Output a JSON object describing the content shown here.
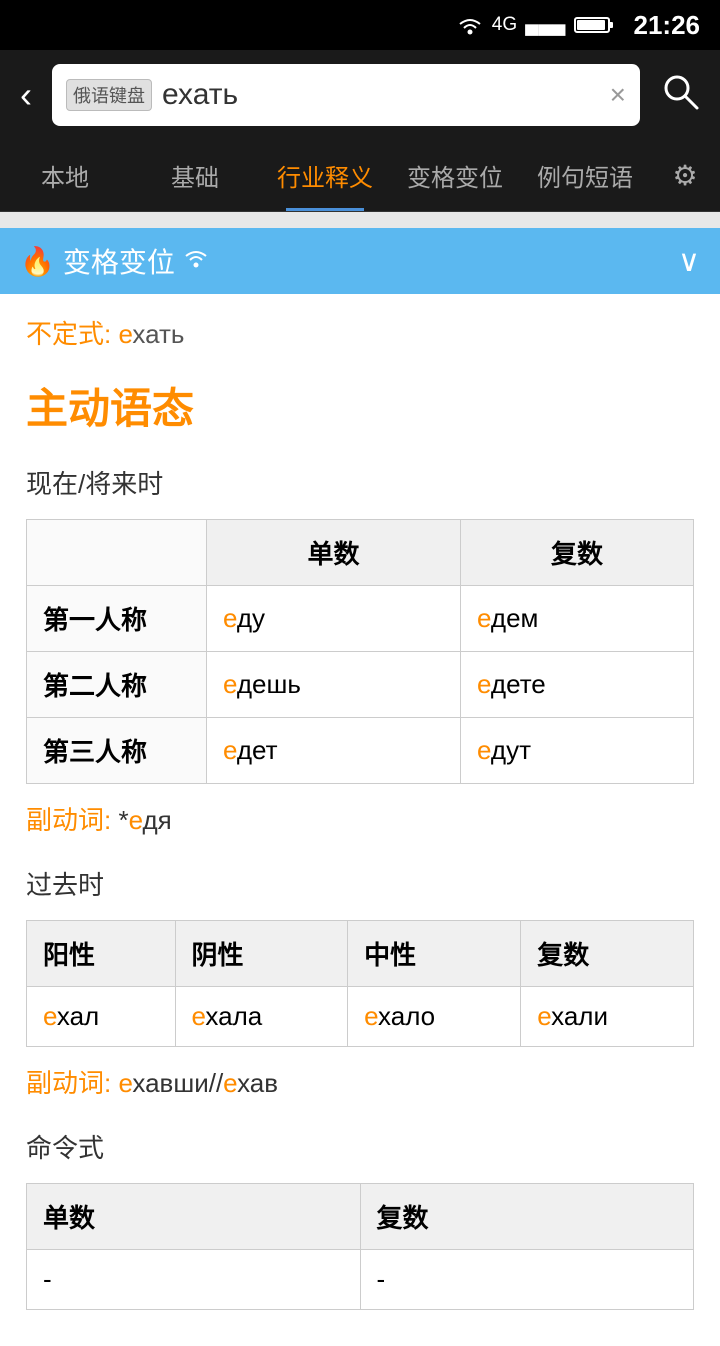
{
  "statusBar": {
    "time": "21:26",
    "icons": [
      "wifi",
      "4g",
      "signal",
      "battery"
    ]
  },
  "topBar": {
    "backLabel": "‹",
    "keyboardBadge": "俄语键盘",
    "searchText": "ехать",
    "clearIcon": "×",
    "searchIcon": "⌕"
  },
  "tabs": [
    {
      "id": "local",
      "label": "本地",
      "active": false
    },
    {
      "id": "basic",
      "label": "基础",
      "active": false
    },
    {
      "id": "industry",
      "label": "行业释义",
      "active": true
    },
    {
      "id": "conjugation",
      "label": "变格变位",
      "active": false
    },
    {
      "id": "examples",
      "label": "例句短语",
      "active": false
    }
  ],
  "settingsIcon": "⚙",
  "blueHeader": {
    "icon": "🔥",
    "title": "变格变位",
    "wifiIcon": "📶",
    "chevron": "⌄"
  },
  "content": {
    "infinitive": {
      "label": "不定式:",
      "orangeChar": "е",
      "rest": "хать"
    },
    "activeVoice": "主动语态",
    "presentFuture": {
      "tenseLabel": "现在/将来时",
      "headers": [
        "",
        "单数",
        "复数"
      ],
      "rows": [
        {
          "person": "第一人称",
          "singular": {
            "orange": "е",
            "rest": "ду"
          },
          "plural": {
            "orange": "е",
            "rest": "дем"
          }
        },
        {
          "person": "第二人称",
          "singular": {
            "orange": "е",
            "rest": "дешь"
          },
          "plural": {
            "orange": "е",
            "rest": "дете"
          }
        },
        {
          "person": "第三人称",
          "singular": {
            "orange": "е",
            "rest": "дет"
          },
          "plural": {
            "orange": "е",
            "rest": "дут"
          }
        }
      ]
    },
    "adverbialParticiple1": {
      "label": "副动词:",
      "prefix": "*",
      "orange": "е",
      "rest": "дя"
    },
    "pastTense": {
      "tenseLabel": "过去时",
      "headers": [
        "阳性",
        "阴性",
        "中性",
        "复数"
      ],
      "rows": [
        {
          "masc": {
            "orange": "е",
            "rest": "хал"
          },
          "fem": {
            "orange": "е",
            "rest": "хала"
          },
          "neut": {
            "orange": "е",
            "rest": "хало"
          },
          "plur": {
            "orange": "е",
            "rest": "хали"
          }
        }
      ]
    },
    "adverbialParticiple2": {
      "label": "副动词:",
      "orange1": "е",
      "rest1": "хавши//",
      "orange2": "е",
      "rest2": "хав"
    },
    "imperative": {
      "tenseLabel": "命令式",
      "headers": [
        "单数",
        "复数"
      ],
      "rows": [
        {
          "singular": "-",
          "plural": "-"
        }
      ]
    }
  }
}
